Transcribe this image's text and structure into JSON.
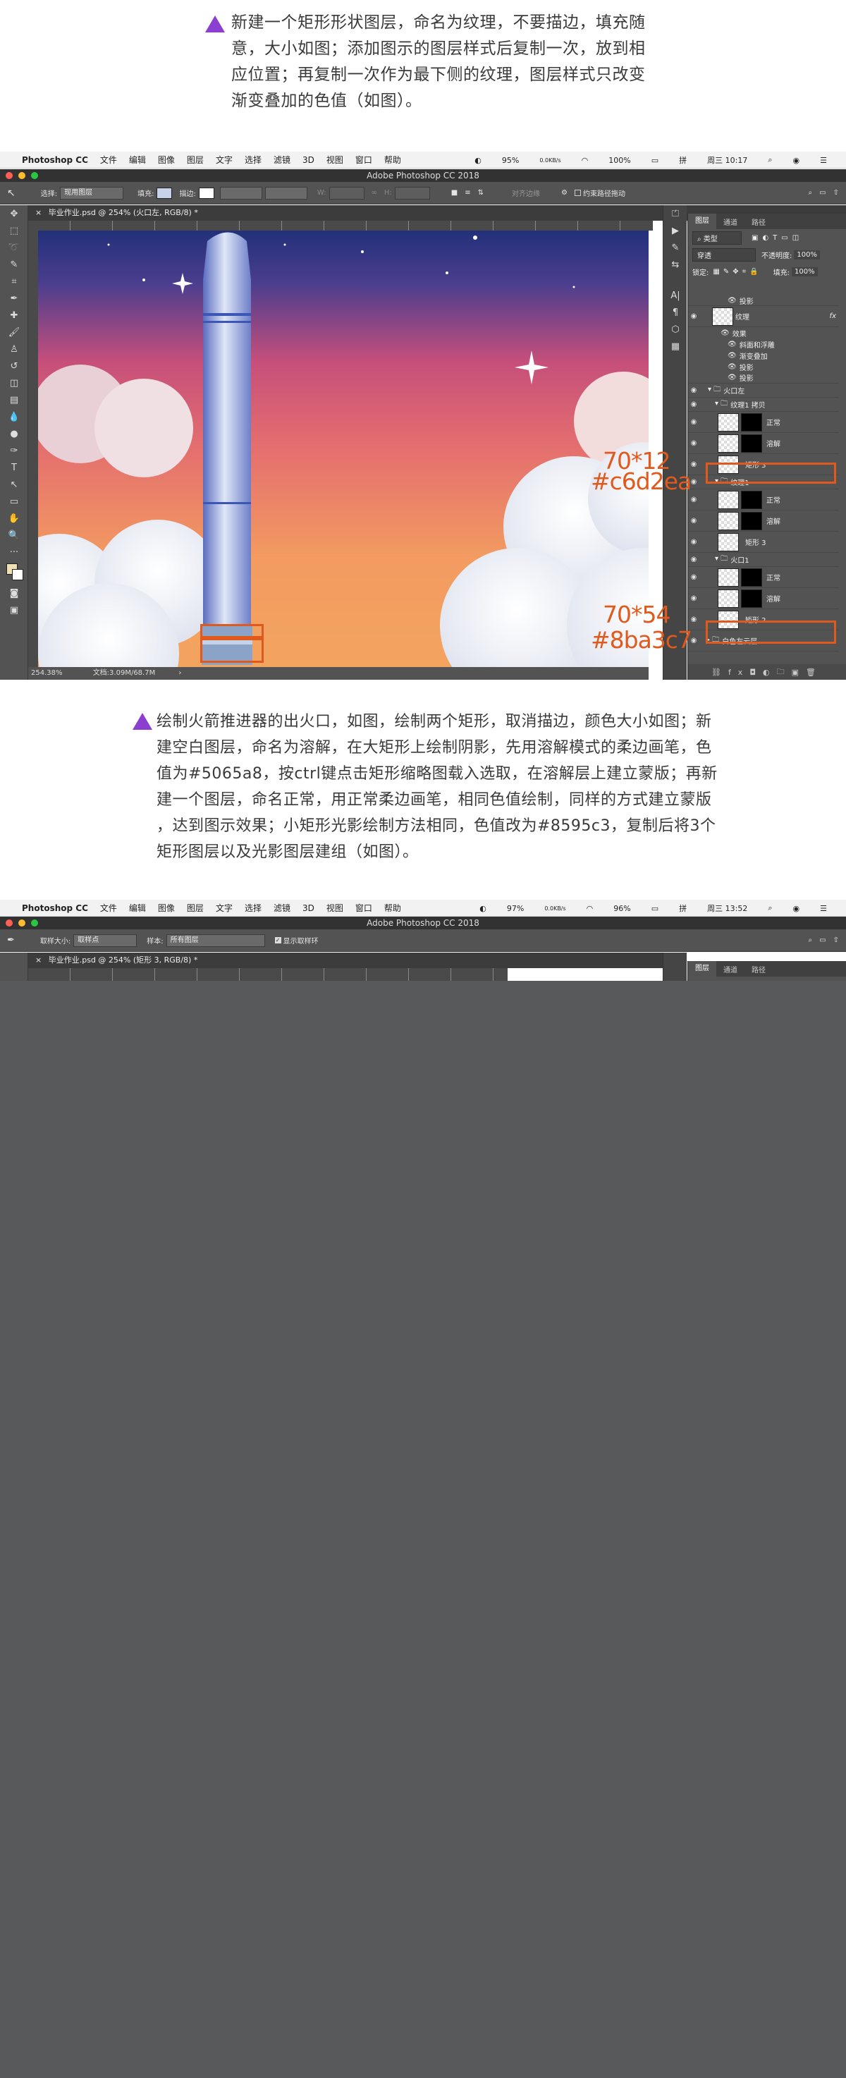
{
  "step1": {
    "line1": "新建一个矩形形状图层，命名为纹理，不要描边，填充随",
    "line2": "意，大小如图；添加图示的图层样式后复制一次，放到相",
    "line3": "应位置；再复制一次作为最下侧的纹理，图层样式只改变",
    "line4": "渐变叠加的色值（如图）。"
  },
  "step2": {
    "line1": "绘制火箭推进器的出火口，如图，绘制两个矩形，取消描边，颜色大小如图；新",
    "line2": "建空白图层，命名为溶解，在大矩形上绘制阴影，先用溶解模式的柔边画笔，色",
    "line3": "值为#5065a8，按ctrl键点击矩形缩略图载入选取，在溶解层上建立蒙版；再新",
    "line4": "建一个图层，命名正常，用正常柔边画笔，相同色值绘制，同样的方式建立蒙版",
    "line5": "，达到图示效果；小矩形光影绘制方法相同，色值改为#8595c3，复制后将3个",
    "line6": "矩形图层以及光影图层建组（如图）。"
  },
  "menubar1": {
    "apple": "",
    "app": "Photoshop CC",
    "items": [
      "文件",
      "编辑",
      "图像",
      "图层",
      "文字",
      "选择",
      "滤镜",
      "3D",
      "视图",
      "窗口",
      "帮助"
    ],
    "battery": "95%",
    "net": "0.0KB/s",
    "wifi_pct": "100%",
    "day": "周三 10:17"
  },
  "menubar2": {
    "app": "Photoshop CC",
    "items": [
      "文件",
      "编辑",
      "图像",
      "图层",
      "文字",
      "选择",
      "滤镜",
      "3D",
      "视图",
      "窗口",
      "帮助"
    ],
    "battery": "97%",
    "net": "0.0KB/s",
    "wifi_pct": "96%",
    "day": "周三 13:52"
  },
  "window1": {
    "title": "Adobe Photoshop CC 2018",
    "opt_select_label": "选择:",
    "opt_select_value": "现用图层",
    "opt_fill": "填充:",
    "opt_stroke": "描边:",
    "opt_w": "W:",
    "opt_h": "H:",
    "opt_align": "对齐边缘",
    "opt_constrain": "约束路径拖动",
    "tab": "毕业作业.psd @ 254% (火口左, RGB/8) *",
    "status_zoom": "254.38%",
    "status_doc": "文档:3.09M/68.7M",
    "panel_tabs": [
      "图层",
      "通道",
      "路径"
    ],
    "filter": "类型",
    "blend": "穿透",
    "opacity_label": "不透明度:",
    "opacity": "100%",
    "lock_label": "锁定:",
    "fill_label": "填充:",
    "fill": "100%",
    "layers": [
      "投影",
      "纹理",
      "效果",
      "斜面和浮雕",
      "渐变叠加",
      "投影",
      "投影",
      "火口左",
      "纹理1 拷贝",
      "正常",
      "溶解",
      "矩形 3",
      "纹理1",
      "正常",
      "溶解",
      "矩形 3",
      "火口1",
      "正常",
      "溶解",
      "矩形 2",
      "白色左云层"
    ],
    "fx": "fx"
  },
  "window2": {
    "title": "Adobe Photoshop CC 2018",
    "opt_size_label": "取样大小:",
    "opt_size_value": "取样点",
    "opt_sample_label": "样本:",
    "opt_sample_value": "所有图层",
    "opt_ring": "显示取样环",
    "tab": "毕业作业.psd @ 254% (矩形 3, RGB/8) *",
    "panel_tabs": [
      "图层",
      "通道",
      "路径"
    ]
  },
  "annotations": {
    "a1_size": "70*12",
    "a1_color": "#c6d2ea",
    "a2_size": "70*54",
    "a2_color": "#8ba3c7"
  },
  "colors": {
    "accent": "#8a3fd1",
    "annotation": "#e05a1e",
    "ps_dark": "#535353",
    "bottom_gray": "#58595b"
  }
}
